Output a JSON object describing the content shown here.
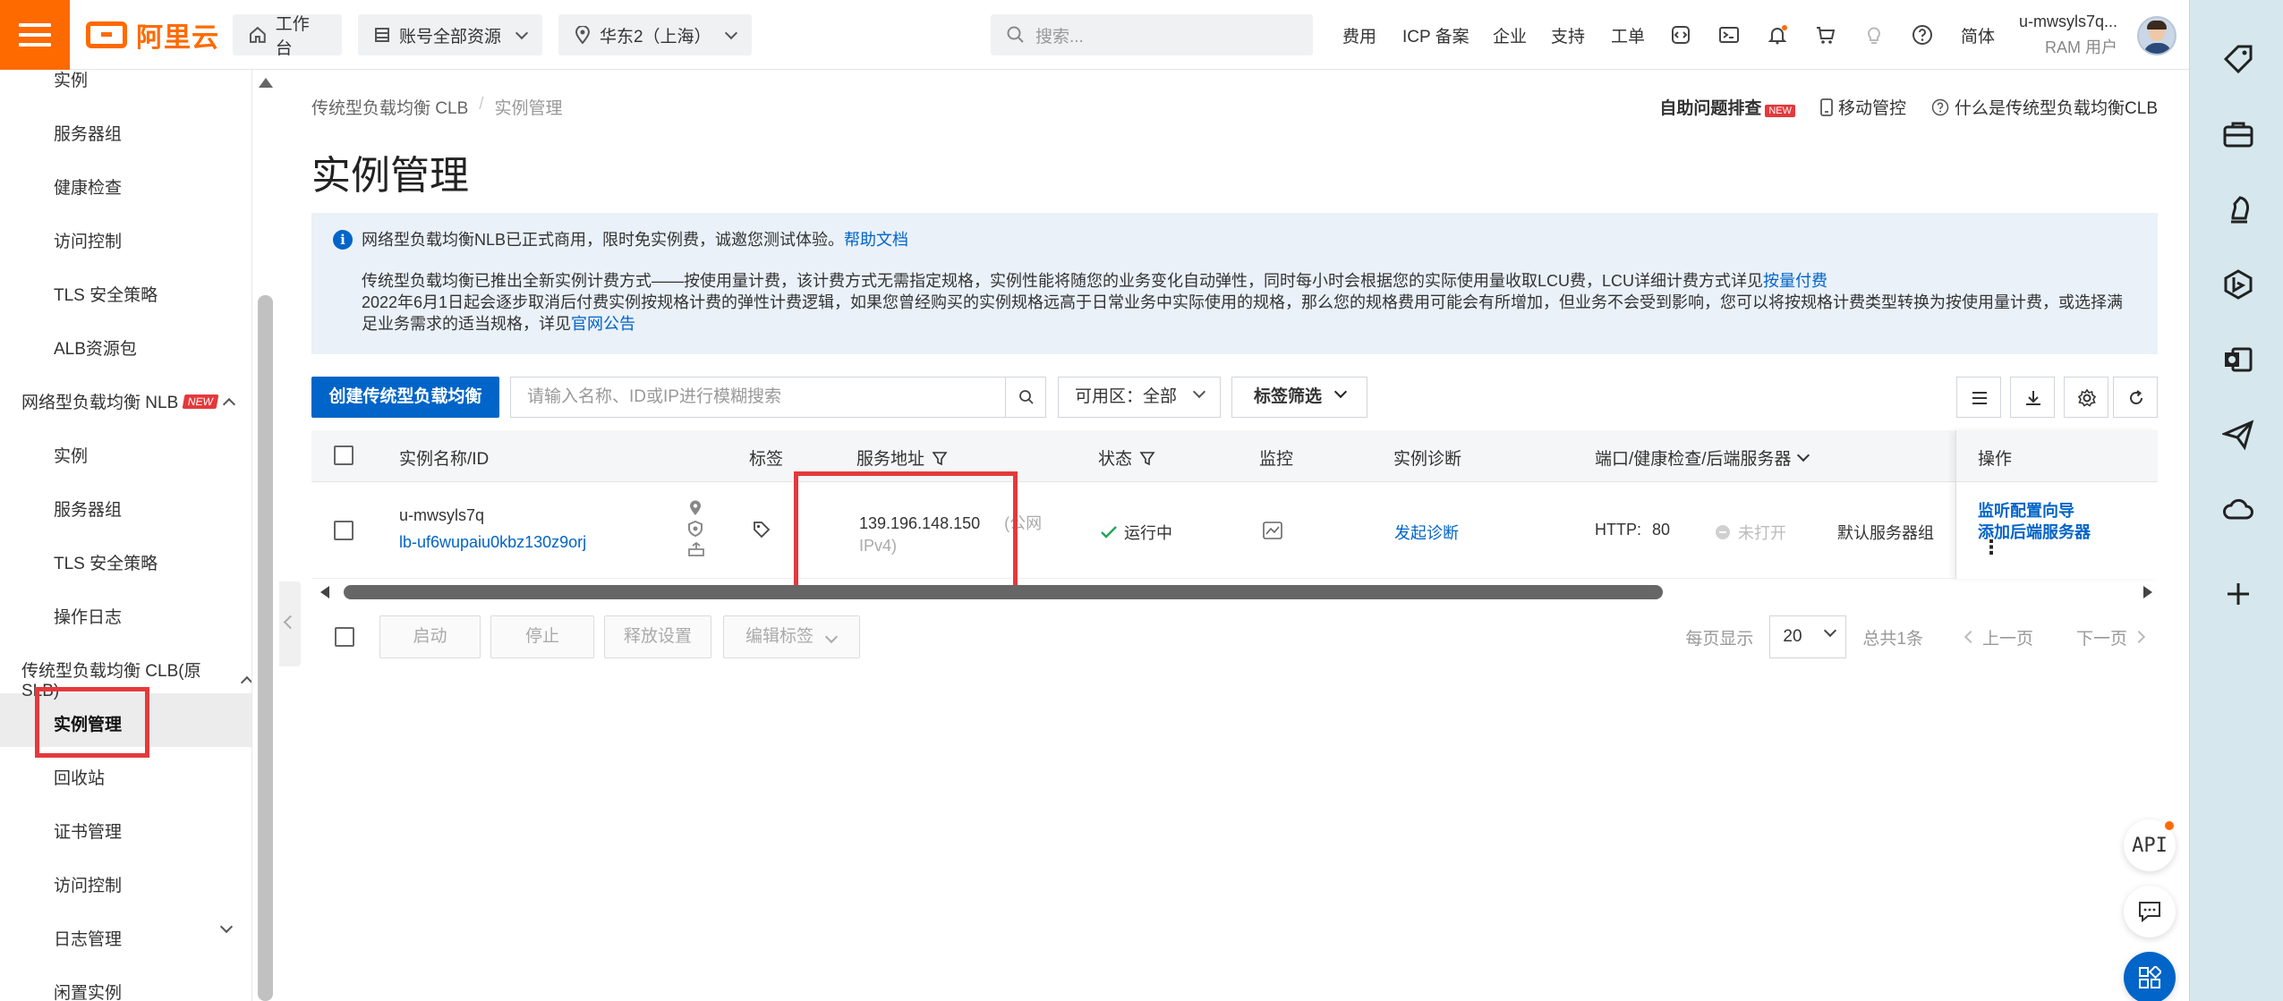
{
  "topbar": {
    "logo_text": "阿里云",
    "workbench": "工作台",
    "resources": "账号全部资源",
    "region": "华东2（上海）",
    "search_placeholder": "搜索...",
    "nav": [
      "费用",
      "ICP 备案",
      "企业",
      "支持",
      "工单",
      "简体"
    ],
    "user_name": "u-mwsyls7q...",
    "user_role": "RAM 用户"
  },
  "sidebar": {
    "items_top": [
      "实例",
      "服务器组",
      "健康检查",
      "访问控制",
      "TLS 安全策略",
      "ALB资源包"
    ],
    "group_nlb": "网络型负载均衡 NLB",
    "group_nlb_badge": "NEW",
    "items_nlb": [
      "实例",
      "服务器组",
      "TLS 安全策略",
      "操作日志"
    ],
    "group_clb": "传统型负载均衡 CLB(原SLB)",
    "items_clb": [
      "实例管理",
      "回收站",
      "证书管理",
      "访问控制",
      "日志管理",
      "闲置实例"
    ]
  },
  "breadcrumb": {
    "parent": "传统型负载均衡 CLB",
    "separator": "/",
    "current": "实例管理"
  },
  "page_title": "实例管理",
  "top_links": {
    "self_help": "自助问题排查",
    "self_help_badge": "NEW",
    "mobile": "移动管控",
    "what_is": "什么是传统型负载均衡CLB"
  },
  "notice": {
    "line1": "网络型负载均衡NLB已正式商用，限时免实例费，诚邀您测试体验。",
    "line1_link": "帮助文档",
    "line2": "传统型负载均衡已推出全新实例计费方式——按使用量计费，该计费方式无需指定规格，实例性能将随您的业务变化自动弹性，同时每小时会根据您的实际使用量收取LCU费，LCU详细计费方式详见",
    "line2_link": "按量付费",
    "line3": "2022年6月1日起会逐步取消后付费实例按规格计费的弹性计费逻辑，如果您曾经购买的实例规格远高于日常业务中实际使用的规格，那么您的规格费用可能会有所增加，但业务不会受到影响，您可以将按规格计费类型转换为按使用量计费，或选择满",
    "line4": "足业务需求的适当规格，详见",
    "line4_link": "官网公告"
  },
  "toolbar": {
    "create_label": "创建传统型负载均衡",
    "filter_placeholder": "请输入名称、ID或IP进行模糊搜索",
    "zone_label": "可用区：",
    "zone_value": "全部",
    "tag_filter": "标签筛选"
  },
  "table": {
    "headers": {
      "name": "实例名称/ID",
      "tag": "标签",
      "address": "服务地址",
      "status": "状态",
      "monitor": "监控",
      "diagnose": "实例诊断",
      "ports": "端口/健康检查/后端服务器",
      "actions": "操作"
    },
    "row": {
      "name": "u-mwsyls7q",
      "id": "lb-uf6wupaiu0kbz130z9orj",
      "ip": "139.196.148.150",
      "ip_type_a": "(公网",
      "ip_type_b": "IPv4)",
      "status": "运行中",
      "diagnose": "发起诊断",
      "protocol": "HTTP:",
      "port": "80",
      "health": "未打开",
      "backend": "默认服务器组",
      "action1": "监听配置向导",
      "action2": "添加后端服务器"
    }
  },
  "footer": {
    "start": "启动",
    "stop": "停止",
    "release": "释放设置",
    "edit_tags": "编辑标签",
    "per_page_label": "每页显示",
    "per_page": "20",
    "total": "总共1条",
    "prev": "上一页",
    "next": "下一页"
  },
  "float": {
    "api": "API"
  },
  "colors": {
    "brand": "#ff6a00",
    "primary": "#0064c8",
    "highlight": "#e4393c",
    "success": "#22a35a"
  }
}
